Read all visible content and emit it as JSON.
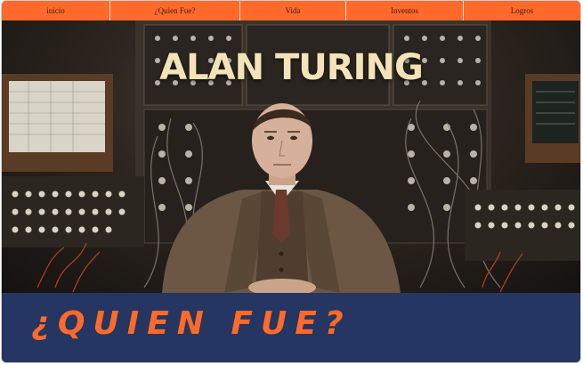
{
  "nav": {
    "items": [
      {
        "label": "inicio"
      },
      {
        "label": "¿Quien Fue?"
      },
      {
        "label": "Vida"
      },
      {
        "label": "Inventos"
      },
      {
        "label": "Logros"
      }
    ]
  },
  "hero": {
    "title": "ALAN TURING",
    "image": "alan-turing-portrait"
  },
  "section": {
    "heading": "¿QUIEN FUE?"
  },
  "colors": {
    "nav_bg": "#ff6a2a",
    "section_bg": "#243661",
    "heading": "#ff6a2a",
    "hero_title": "#f3e3b6"
  }
}
